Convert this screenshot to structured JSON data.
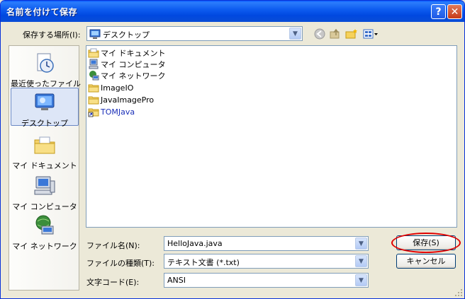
{
  "window": {
    "title": "名前を付けて保存",
    "help_label": "?",
    "close_label": "✕"
  },
  "toolbar": {
    "location_label": "保存する場所(I):",
    "location_value": "デスクトップ"
  },
  "places": [
    {
      "label": "最近使ったファイル",
      "icon": "recent-clock-icon"
    },
    {
      "label": "デスクトップ",
      "icon": "desktop-icon",
      "selected": true
    },
    {
      "label": "マイ ドキュメント",
      "icon": "my-documents-icon"
    },
    {
      "label": "マイ コンピュータ",
      "icon": "my-computer-icon"
    },
    {
      "label": "マイ ネットワーク",
      "icon": "my-network-icon"
    }
  ],
  "files": [
    {
      "name": "マイ ドキュメント",
      "icon": "documents-folder-icon"
    },
    {
      "name": "マイ コンピュータ",
      "icon": "computer-icon"
    },
    {
      "name": "マイ ネットワーク",
      "icon": "network-icon"
    },
    {
      "name": "ImageIO",
      "icon": "folder-icon"
    },
    {
      "name": "JavaImagePro",
      "icon": "folder-icon"
    },
    {
      "name": "TOMJava",
      "icon": "folder-shortcut-icon",
      "color": "#1a2fb8"
    }
  ],
  "form": {
    "filename_label": "ファイル名(N):",
    "filename_value": "HelloJava.java",
    "filetype_label": "ファイルの種類(T):",
    "filetype_value": "テキスト文書 (*.txt)",
    "encoding_label": "文字コード(E):",
    "encoding_value": "ANSI"
  },
  "buttons": {
    "save": "保存(S)",
    "cancel": "キャンセル"
  },
  "colors": {
    "title_blue": "#0048e0",
    "highlight_red": "#e00000"
  }
}
